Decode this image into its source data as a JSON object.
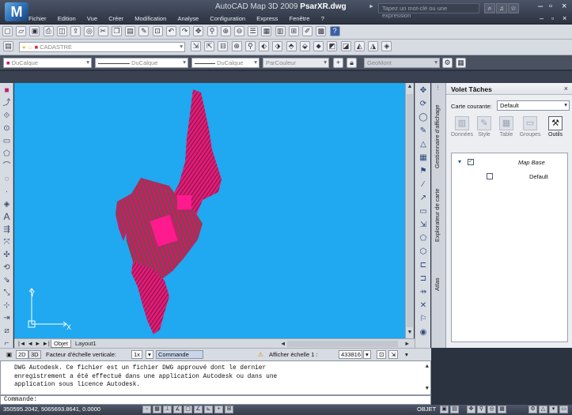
{
  "app": {
    "title_prefix": "AutoCAD Map 3D 2009",
    "file_name": "PsarXR.dwg",
    "search_placeholder": "Tapez un mot-clé ou une expression"
  },
  "menu": [
    "Fichier",
    "Edition",
    "Vue",
    "Créer",
    "Modification",
    "Analyse",
    "Configuration",
    "Express",
    "Fenêtre",
    "?"
  ],
  "toolbar": {
    "layer_name": "CADASTRE",
    "color_value": "DuCalque",
    "linetype_value": "DuCalque",
    "lineweight_value": "DuCalque",
    "plotstyle_value": "ParCouleur",
    "geomont_value": "GeoMont"
  },
  "drawing": {
    "ucs_x": "X",
    "ucs_y": "Y",
    "model_tab": "Objet",
    "layout_tab": "Layout1",
    "colors": {
      "background": "#20a8f0",
      "parcels": "#e8187a",
      "parcels_dark": "#4a6b2a"
    }
  },
  "statusbar": {
    "view_2d": "2D",
    "view_3d": "3D",
    "vertical_scale_label": "Facteur d'échelle verticale:",
    "vertical_scale_value": "1x",
    "command_label": "Commande",
    "show_scale_label": "Afficher échelle 1 :",
    "scale_value": "433816"
  },
  "command": {
    "history": [
      "DWG Autodesk.  Ce fichier est un fichier DWG approuvé dont le dernier",
      "enregistrement a été effectué dans une application Autodesk ou dans une",
      "application sous licence Autodesk."
    ],
    "prompt": "Commande:"
  },
  "bottom": {
    "coords": "350595.2042, 5065693.8641, 0.0000",
    "objet_label": "OBJET"
  },
  "taskpane": {
    "title": "Volet Tâches",
    "current_map_label": "Carte courante:",
    "current_map_value": "Default",
    "tools": [
      "Données",
      "Style",
      "Table",
      "Groupes",
      "Outils"
    ],
    "tree": {
      "root": "Map Base",
      "child": "Default"
    },
    "vertical_tabs": [
      "Gestionnaire d'affichage",
      "Explorateur de carte",
      "Atlas"
    ]
  }
}
